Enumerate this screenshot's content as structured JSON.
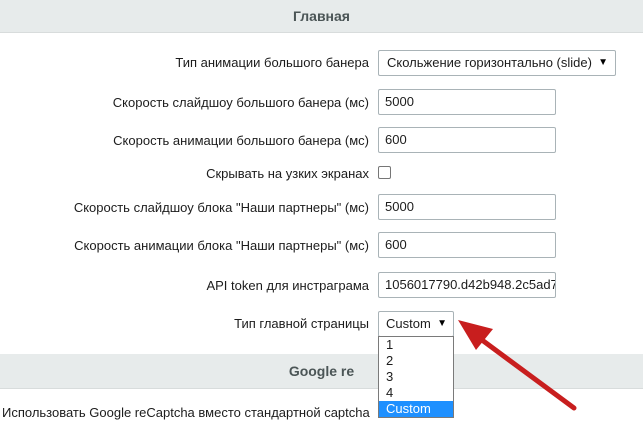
{
  "section_main": {
    "title": "Главная"
  },
  "fields": {
    "banner_animation_type": {
      "label": "Тип анимации большого банера",
      "value": "Скольжение горизонтально (slide)"
    },
    "banner_slideshow_speed": {
      "label": "Скорость слайдшоу большого банера (мс)",
      "value": "5000"
    },
    "banner_animation_speed": {
      "label": "Скорость анимации большого банера (мс)",
      "value": "600"
    },
    "hide_on_narrow": {
      "label": "Скрывать на узких экранах",
      "checked": false
    },
    "partners_slideshow_speed": {
      "label": "Скорость слайдшоу блока \"Наши партнеры\" (мс)",
      "value": "5000"
    },
    "partners_animation_speed": {
      "label": "Скорость анимации блока \"Наши партнеры\" (мс)",
      "value": "600"
    },
    "instagram_token": {
      "label": "API token для инстраграма",
      "value": "1056017790.d42b948.2c5ad7"
    },
    "homepage_type": {
      "label": "Тип главной страницы",
      "value": "Custom",
      "options": [
        "1",
        "2",
        "3",
        "4",
        "Custom"
      ],
      "selected": "Custom"
    }
  },
  "section_google": {
    "title": "Google re"
  },
  "recaptcha": {
    "label": "Использовать Google reCaptcha вместо стандартной captcha"
  },
  "annotation": {
    "arrow_color": "#c81e1e"
  },
  "icons": {
    "caret": "caret-down-icon"
  }
}
